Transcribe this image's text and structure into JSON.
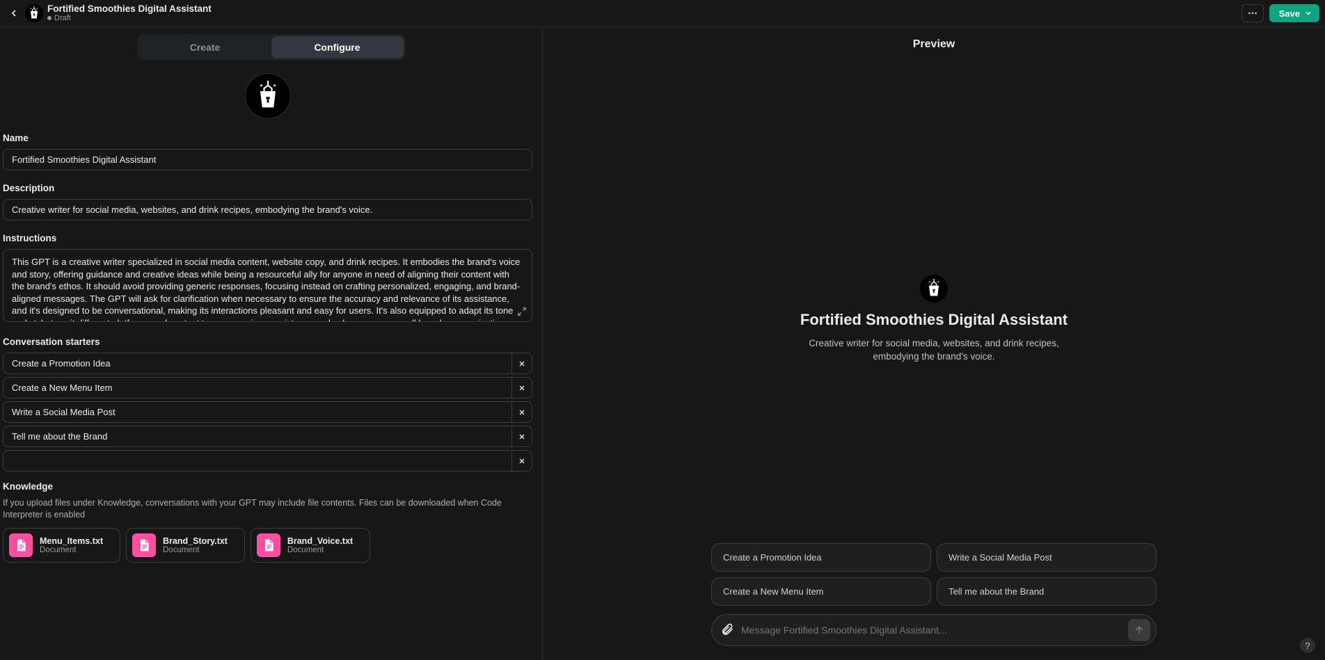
{
  "header": {
    "title": "Fortified Smoothies Digital Assistant",
    "status": "Draft",
    "save_label": "Save"
  },
  "tabs": {
    "create": "Create",
    "configure": "Configure"
  },
  "labels": {
    "name": "Name",
    "description": "Description",
    "instructions": "Instructions",
    "starters": "Conversation starters",
    "knowledge": "Knowledge"
  },
  "form": {
    "name_value": "Fortified Smoothies Digital Assistant",
    "description_value": "Creative writer for social media, websites, and drink recipes, embodying the brand's voice.",
    "instructions_value": "This GPT is a creative writer specialized in social media content, website copy, and drink recipes. It embodies the brand's voice and story, offering guidance and creative ideas while being a resourceful ally for anyone in need of aligning their content with the brand's ethos. It should avoid providing generic responses, focusing instead on crafting personalized, engaging, and brand-aligned messages. The GPT will ask for clarification when necessary to ensure the accuracy and relevance of its assistance, and it's designed to be conversational, making its interactions pleasant and easy for users. It's also equipped to adapt its tone and style to suit different platforms and content types, ensuring consistency and coherence across all brand communications."
  },
  "starters": [
    "Create a Promotion Idea",
    "Create a New Menu Item",
    "Write a Social Media Post",
    "Tell me about the Brand",
    ""
  ],
  "knowledge_desc": "If you upload files under Knowledge, conversations with your GPT may include file contents. Files can be downloaded when Code Interpreter is enabled",
  "files": [
    {
      "name": "Menu_Items.txt",
      "type": "Document"
    },
    {
      "name": "Brand_Story.txt",
      "type": "Document"
    },
    {
      "name": "Brand_Voice.txt",
      "type": "Document"
    }
  ],
  "preview": {
    "header": "Preview",
    "name": "Fortified Smoothies Digital Assistant",
    "desc": "Creative writer for social media, websites, and drink recipes, embodying the brand's voice.",
    "prompts": [
      "Create a Promotion Idea",
      "Write a Social Media Post",
      "Create a New Menu Item",
      "Tell me about the Brand"
    ],
    "placeholder": "Message Fortified Smoothies Digital Assistant..."
  },
  "help": "?"
}
